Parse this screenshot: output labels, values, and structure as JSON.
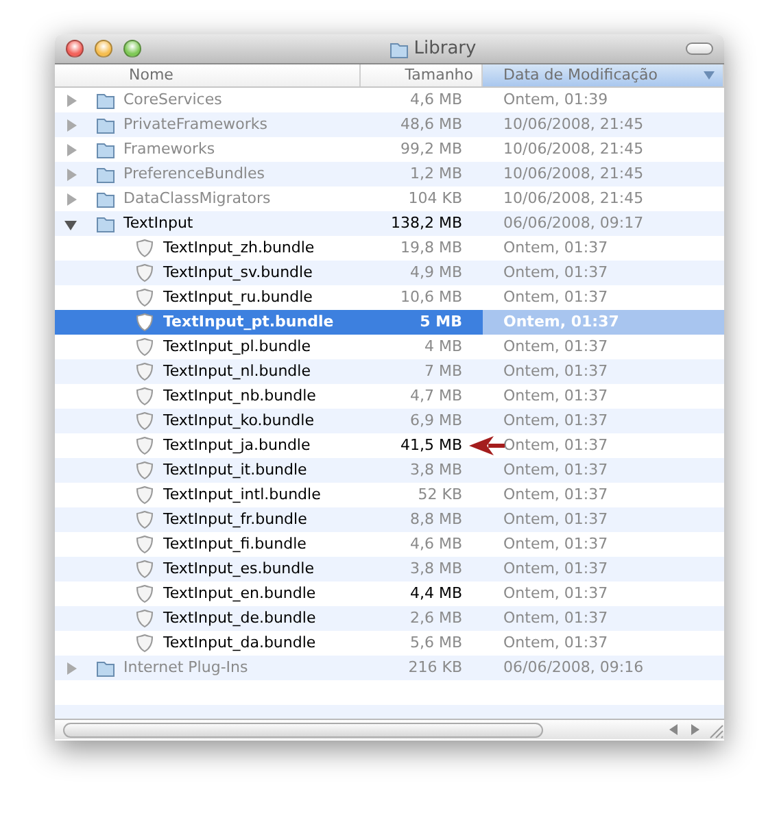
{
  "window": {
    "title": "Library"
  },
  "columns": [
    {
      "label": "Nome",
      "sorted": false
    },
    {
      "label": "Tamanho",
      "sorted": false
    },
    {
      "label": "Data de Modificação",
      "sorted": true
    }
  ],
  "rows": [
    {
      "kind": "folder",
      "name": "CoreServices",
      "size": "4,6 MB",
      "date": "Ontem, 01:39",
      "expanded": false,
      "selected": false,
      "dimmed": true,
      "size_bold": false
    },
    {
      "kind": "folder",
      "name": "PrivateFrameworks",
      "size": "48,6 MB",
      "date": "10/06/2008, 21:45",
      "expanded": false,
      "selected": false,
      "dimmed": true,
      "size_bold": false
    },
    {
      "kind": "folder",
      "name": "Frameworks",
      "size": "99,2 MB",
      "date": "10/06/2008, 21:45",
      "expanded": false,
      "selected": false,
      "dimmed": true,
      "size_bold": false
    },
    {
      "kind": "folder",
      "name": "PreferenceBundles",
      "size": "1,2 MB",
      "date": "10/06/2008, 21:45",
      "expanded": false,
      "selected": false,
      "dimmed": true,
      "size_bold": false
    },
    {
      "kind": "folder",
      "name": "DataClassMigrators",
      "size": "104 KB",
      "date": "10/06/2008, 21:45",
      "expanded": false,
      "selected": false,
      "dimmed": true,
      "size_bold": false
    },
    {
      "kind": "folder",
      "name": "TextInput",
      "size": "138,2 MB",
      "date": "06/06/2008, 09:17",
      "expanded": true,
      "selected": false,
      "dimmed": false,
      "size_bold": true,
      "children": [
        {
          "kind": "bundle",
          "name": "TextInput_zh.bundle",
          "size": "19,8 MB",
          "date": "Ontem, 01:37",
          "selected": false,
          "dimmed": false,
          "size_bold": false
        },
        {
          "kind": "bundle",
          "name": "TextInput_sv.bundle",
          "size": "4,9 MB",
          "date": "Ontem, 01:37",
          "selected": false,
          "dimmed": false,
          "size_bold": false
        },
        {
          "kind": "bundle",
          "name": "TextInput_ru.bundle",
          "size": "10,6 MB",
          "date": "Ontem, 01:37",
          "selected": false,
          "dimmed": false,
          "size_bold": false
        },
        {
          "kind": "bundle",
          "name": "TextInput_pt.bundle",
          "size": "5 MB",
          "date": "Ontem, 01:37",
          "selected": true,
          "dimmed": false,
          "size_bold": false
        },
        {
          "kind": "bundle",
          "name": "TextInput_pl.bundle",
          "size": "4 MB",
          "date": "Ontem, 01:37",
          "selected": false,
          "dimmed": false,
          "size_bold": false
        },
        {
          "kind": "bundle",
          "name": "TextInput_nl.bundle",
          "size": "7 MB",
          "date": "Ontem, 01:37",
          "selected": false,
          "dimmed": false,
          "size_bold": false
        },
        {
          "kind": "bundle",
          "name": "TextInput_nb.bundle",
          "size": "4,7 MB",
          "date": "Ontem, 01:37",
          "selected": false,
          "dimmed": false,
          "size_bold": false
        },
        {
          "kind": "bundle",
          "name": "TextInput_ko.bundle",
          "size": "6,9 MB",
          "date": "Ontem, 01:37",
          "selected": false,
          "dimmed": false,
          "size_bold": false
        },
        {
          "kind": "bundle",
          "name": "TextInput_ja.bundle",
          "size": "41,5 MB",
          "date": "Ontem, 01:37",
          "selected": false,
          "dimmed": false,
          "size_bold": true,
          "marked": true
        },
        {
          "kind": "bundle",
          "name": "TextInput_it.bundle",
          "size": "3,8 MB",
          "date": "Ontem, 01:37",
          "selected": false,
          "dimmed": false,
          "size_bold": false
        },
        {
          "kind": "bundle",
          "name": "TextInput_intl.bundle",
          "size": "52 KB",
          "date": "Ontem, 01:37",
          "selected": false,
          "dimmed": false,
          "size_bold": false
        },
        {
          "kind": "bundle",
          "name": "TextInput_fr.bundle",
          "size": "8,8 MB",
          "date": "Ontem, 01:37",
          "selected": false,
          "dimmed": false,
          "size_bold": false
        },
        {
          "kind": "bundle",
          "name": "TextInput_fi.bundle",
          "size": "4,6 MB",
          "date": "Ontem, 01:37",
          "selected": false,
          "dimmed": false,
          "size_bold": false
        },
        {
          "kind": "bundle",
          "name": "TextInput_es.bundle",
          "size": "3,8 MB",
          "date": "Ontem, 01:37",
          "selected": false,
          "dimmed": false,
          "size_bold": false
        },
        {
          "kind": "bundle",
          "name": "TextInput_en.bundle",
          "size": "4,4 MB",
          "date": "Ontem, 01:37",
          "selected": false,
          "dimmed": false,
          "size_bold": true
        },
        {
          "kind": "bundle",
          "name": "TextInput_de.bundle",
          "size": "2,6 MB",
          "date": "Ontem, 01:37",
          "selected": false,
          "dimmed": false,
          "size_bold": false
        },
        {
          "kind": "bundle",
          "name": "TextInput_da.bundle",
          "size": "5,6 MB",
          "date": "Ontem, 01:37",
          "selected": false,
          "dimmed": false,
          "size_bold": false
        }
      ]
    },
    {
      "kind": "folder",
      "name": "Internet Plug-Ins",
      "size": "216 KB",
      "date": "06/06/2008, 09:16",
      "expanded": false,
      "selected": false,
      "dimmed": true,
      "size_bold": false
    }
  ]
}
